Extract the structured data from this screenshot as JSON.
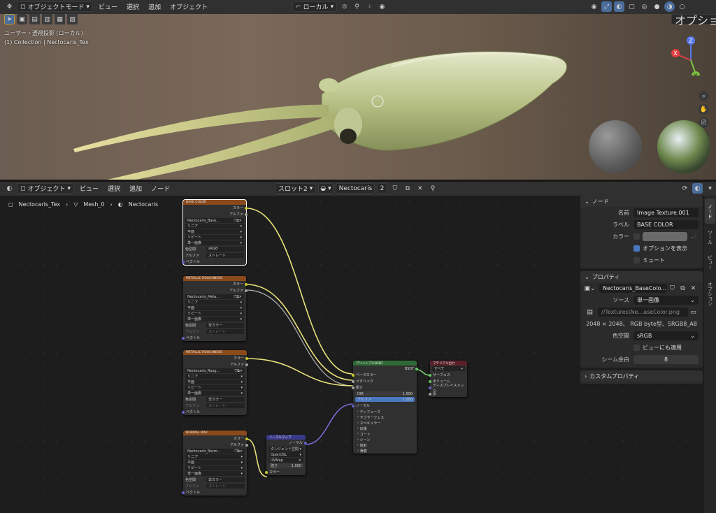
{
  "topbar": {
    "mode": "オブジェクトモード",
    "menus": [
      "ビュー",
      "選択",
      "追加",
      "オブジェクト"
    ],
    "transform_orientation": "ローカル"
  },
  "viewport": {
    "view_name": "ユーザー・透視投影 (ローカル)",
    "collection_info": "(1) Collection | Nectocaris_Tex",
    "options_label": "オプション",
    "gizmo": {
      "x": "X",
      "y": "Y",
      "z": "Z"
    }
  },
  "node_header": {
    "editor_mode": "オブジェクト",
    "menus": [
      "ビュー",
      "選択",
      "追加",
      "ノード"
    ],
    "slot": "スロット2",
    "material": "Nectocaris",
    "users": "2"
  },
  "breadcrumb": [
    "Nectocaris_Tex",
    "Mesh_0",
    "Nectocaris"
  ],
  "colors": {
    "tex_header": "#8a4a1c",
    "bsdf_header": "#2e6a35",
    "output_header": "#5a1f2a",
    "vector_header": "#3a3a8a",
    "link_yellow": "#e8e27a",
    "link_grey": "#b4b4b4",
    "link_purple": "#7a6ad8",
    "accent": "#4a78c0"
  },
  "nodes": {
    "t1": {
      "title": "BASE COLOR",
      "out_color": "カラー",
      "out_alpha": "アルファ",
      "image": "Nectocaris_Base...",
      "interp": "リニア",
      "proj": "平面",
      "ext": "リピート",
      "src": "単一画像",
      "cs_label": "色空間",
      "cs": "sRGB",
      "al_label": "アルファ",
      "al": "ストレート",
      "vec": "ベクトル"
    },
    "t2": {
      "title": "METALLIC ROUGHNESS",
      "out_color": "カラー",
      "out_alpha": "アルファ",
      "image": "Nectocaris_Meta...",
      "interp": "リニア",
      "proj": "平面",
      "ext": "リピート",
      "src": "単一画像",
      "cs_label": "色空間",
      "cs": "非カラー",
      "al_label": "アルファ",
      "al": "ストレート",
      "vec": "ベクトル"
    },
    "t3": {
      "title": "METALLIC ROUGHNESS",
      "out_color": "カラー",
      "out_alpha": "アルファ",
      "image": "Nectocaris_Roug...",
      "interp": "リニア",
      "proj": "平面",
      "ext": "リピート",
      "src": "単一画像",
      "cs_label": "色空間",
      "cs": "非カラー",
      "al_label": "アルファ",
      "al": "ストレート",
      "vec": "ベクトル"
    },
    "t4": {
      "title": "NORMAL MAP",
      "out_color": "カラー",
      "out_alpha": "アルファ",
      "image": "Nectocaris_Norm...",
      "interp": "リニア",
      "proj": "平面",
      "ext": "リピート",
      "src": "単一画像",
      "cs_label": "色空間",
      "cs": "非カラー",
      "al_label": "アルファ",
      "al": "ストレート",
      "vec": "ベクトル"
    },
    "nm": {
      "title": "ノーマルマップ",
      "out": "ノーマル",
      "space": "タンジェント空間",
      "uv_method": "OpenUSL",
      "uv": "UVMap",
      "str_label": "強さ",
      "str": "1.000",
      "in_color": "カラー"
    },
    "bsdf": {
      "title": "プリンシプルBSDF",
      "out": "BSDF",
      "base": "ベースカラー",
      "metal": "メタリック",
      "rough": "粗さ",
      "ior_label": "IOR",
      "ior": "1.500",
      "alpha_label": "アルファ",
      "alpha": "1.000",
      "normal": "ノーマル",
      "subs": [
        "ディフューズ",
        "サブサーフェス",
        "スペキュラー",
        "伝播",
        "コート",
        "シーン",
        "放射",
        "薄膜"
      ]
    },
    "out": {
      "title": "マテリアル出力",
      "target": "すべて",
      "surface": "サーフェス",
      "volume": "ボリューム",
      "disp": "ディスプレイスメント",
      "thick": "厚"
    }
  },
  "panel": {
    "node_section": "ノード",
    "name_label": "名前",
    "name": "Image Texture.001",
    "label_label": "ラベル",
    "label": "BASE COLOR",
    "color_label": "カラー",
    "show_options": "オプションを表示",
    "mute": "ミュート",
    "prop_section": "プロパティ",
    "image_name": "Nectocaris_BaseColo...",
    "source_label": "ソース",
    "source": "単一画像",
    "filepath": "//Textures\\Ne...aseColor.png",
    "info": "2048 × 2048、 RGB byte型、SRGB8_A8",
    "colorspace_label": "色空間",
    "colorspace": "sRGB",
    "view_as_render": "ビューにも適用",
    "seam_label": "シーム余白",
    "seam": "8",
    "custom_section": "カスタムプロパティ"
  },
  "side_tabs": [
    "ノード",
    "ツール",
    "ビュー",
    "オプション"
  ]
}
